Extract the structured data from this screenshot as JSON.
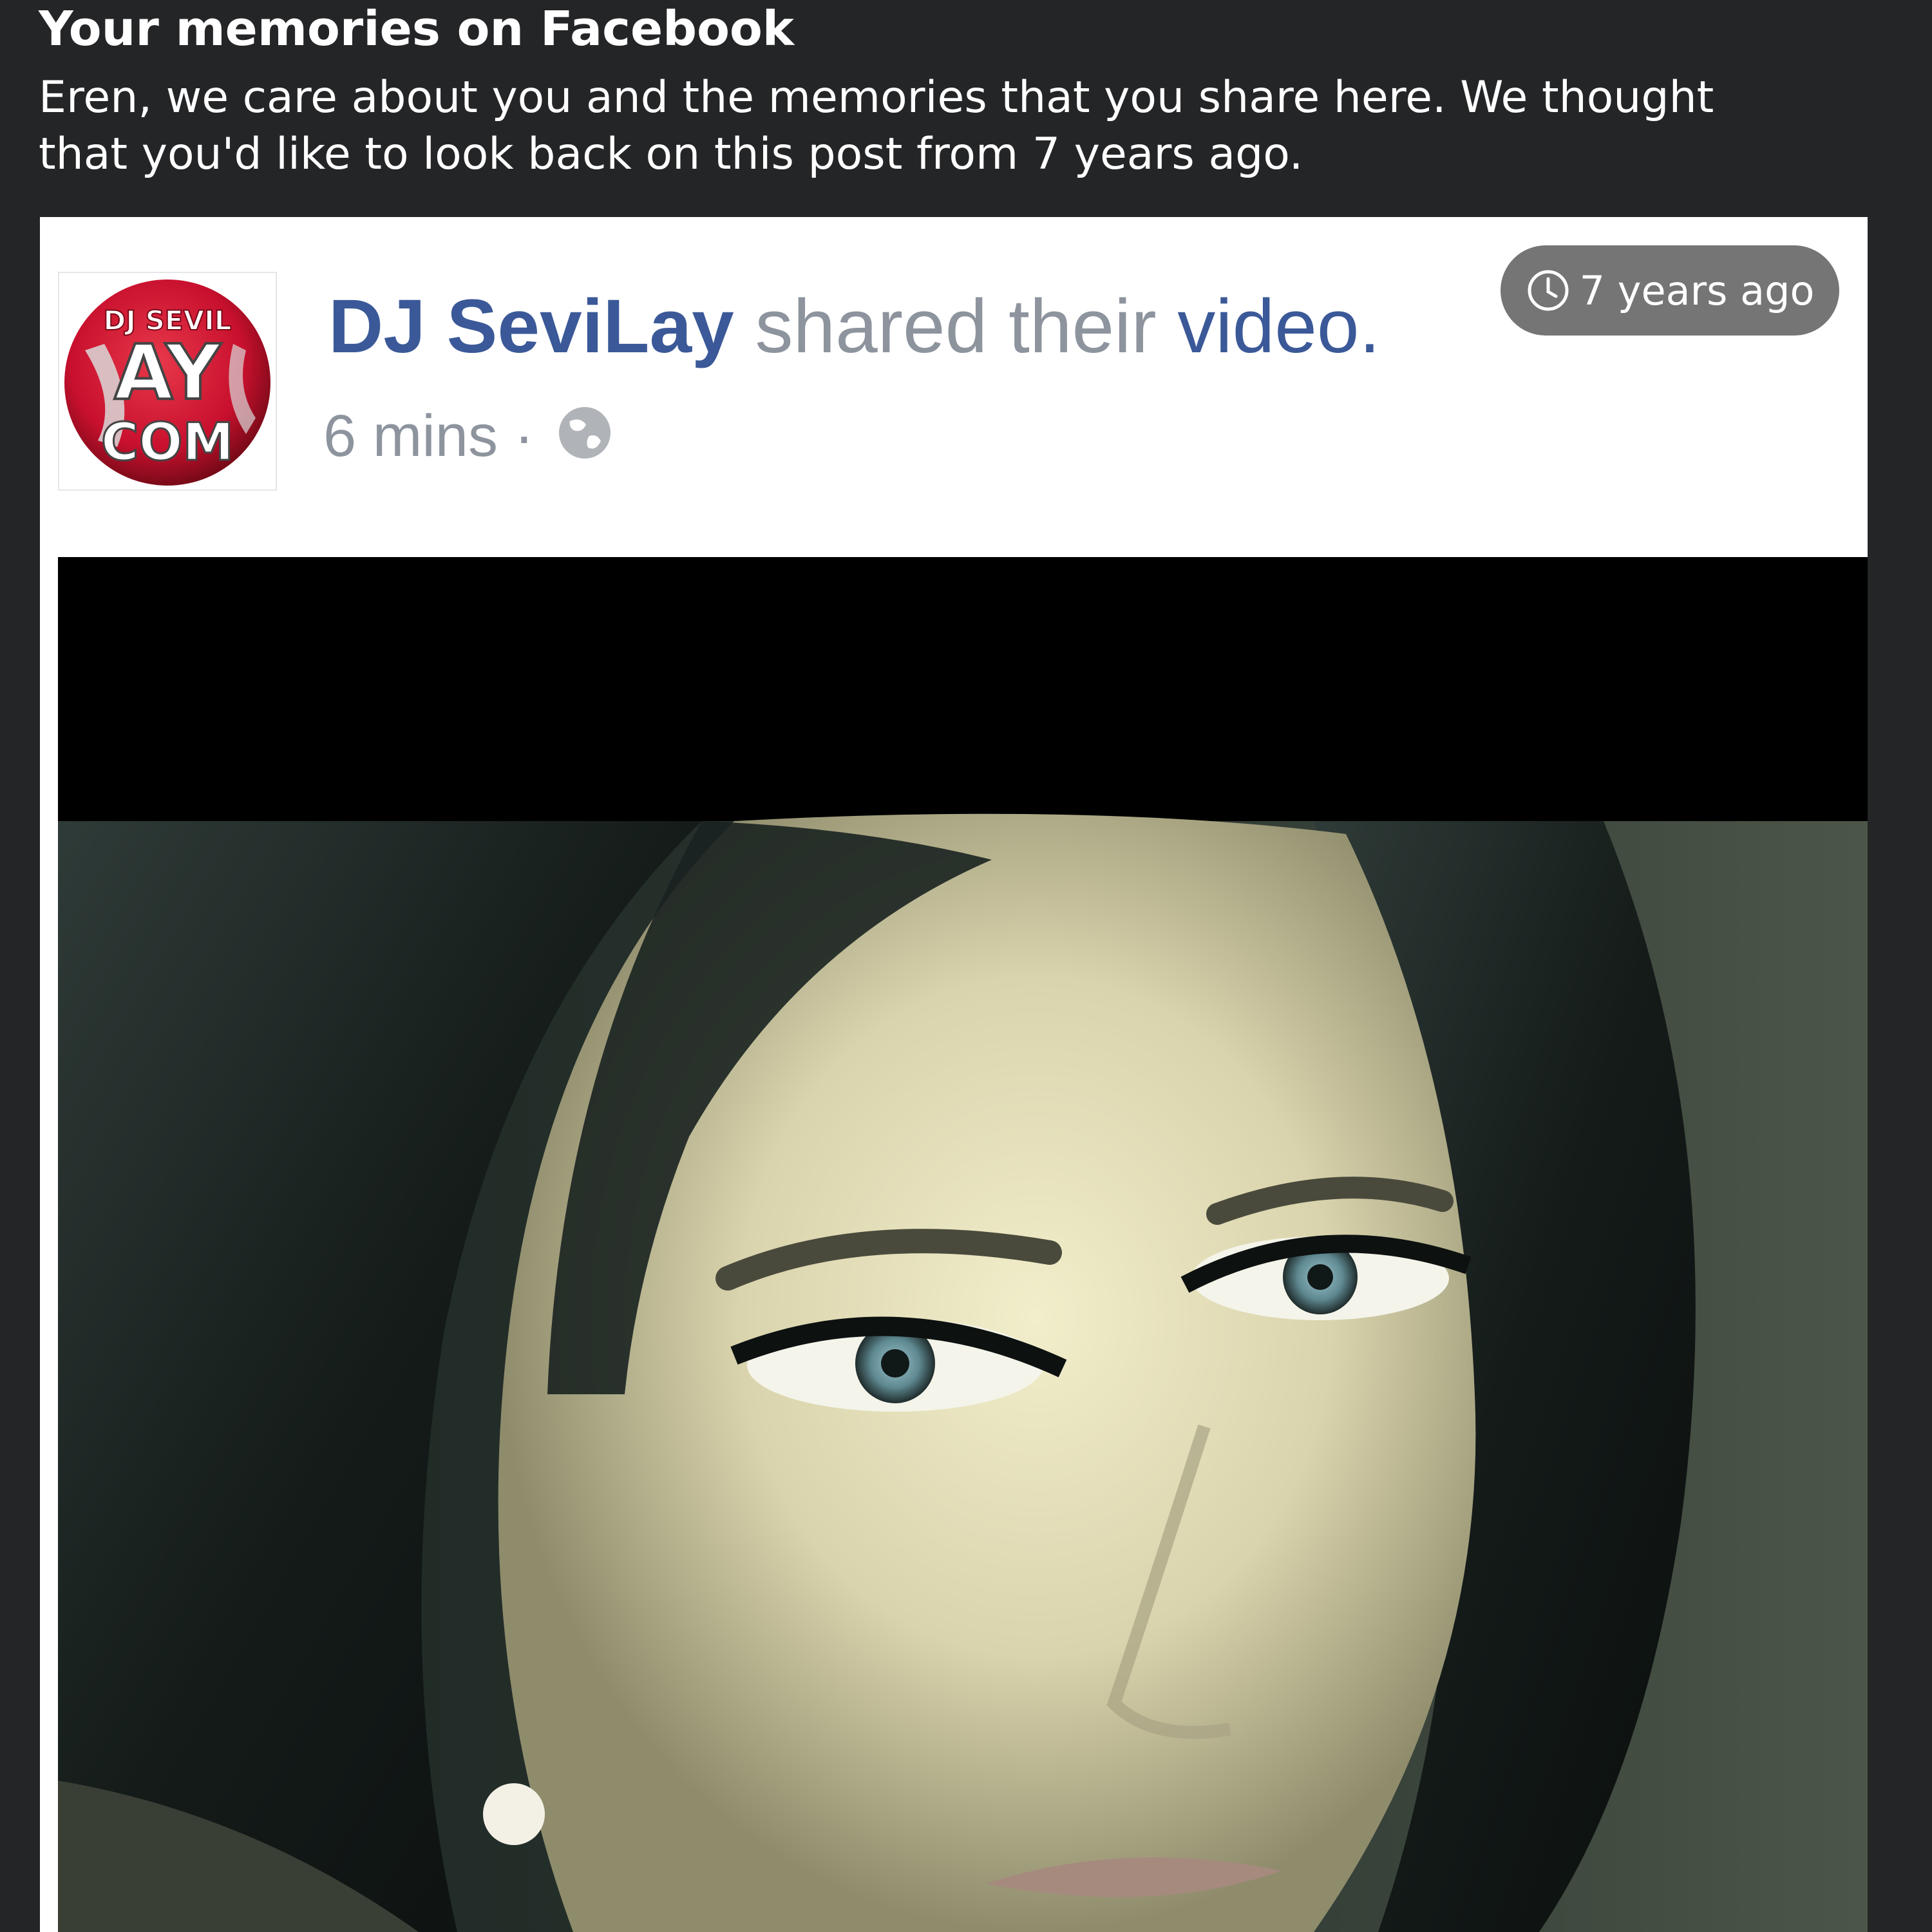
{
  "memories": {
    "title": "Your memories on Facebook",
    "description": "Eren, we care about you and the memories that you share here. We thought that you'd like to look back on this post from 7 years ago."
  },
  "post": {
    "poster_name": "DJ SeviLay",
    "action_text": " shared their ",
    "object_text": "video.",
    "time_text": "6 mins",
    "separator": " · ",
    "privacy_icon": "globe-icon",
    "timestamp_badge": "7 years ago",
    "timestamp_icon": "clock-icon",
    "avatar_logo_text": [
      "DJ SEVIL",
      "AY",
      "COM"
    ]
  },
  "colors": {
    "background": "#242527",
    "link_blue": "#3b5998",
    "meta_gray": "#8d949e",
    "badge_gray": "#757575",
    "avatar_red": "#c8102e"
  }
}
